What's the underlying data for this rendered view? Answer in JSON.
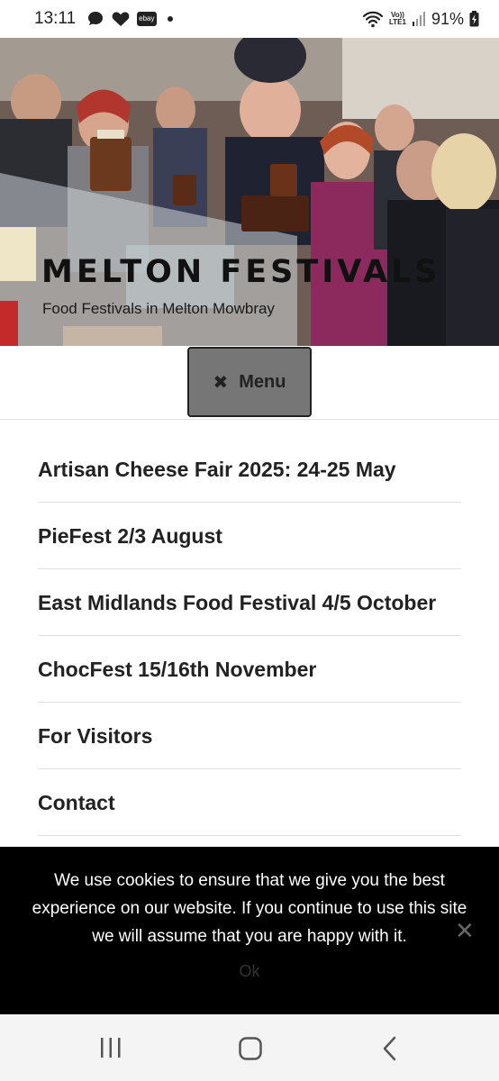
{
  "status_bar": {
    "time": "13:11",
    "ebay_label": "ebay",
    "volte_top": "Vo))",
    "volte_bottom": "LTE1",
    "battery": "91%",
    "icons": [
      "chat-bubble-icon",
      "heart-icon",
      "ebay-icon",
      "notification-dot-icon",
      "wifi-icon",
      "signal-icon",
      "battery-icon"
    ]
  },
  "header": {
    "site_title": "MELTON FESTIVALS",
    "tagline": "Food Festivals in Melton Mowbray"
  },
  "menu_toggle": {
    "label": "Menu",
    "icon": "close-icon"
  },
  "nav": {
    "items": [
      {
        "label": "Artisan Cheese Fair 2025: 24-25 May"
      },
      {
        "label": "PieFest 2/3 August"
      },
      {
        "label": "East Midlands Food Festival 4/5 October"
      },
      {
        "label": "ChocFest 15/16th November"
      },
      {
        "label": "For Visitors"
      },
      {
        "label": "Contact"
      }
    ]
  },
  "cookie_notice": {
    "text": "We use cookies to ensure that we give you the best experience on our website. If you continue to use this site we will assume that you are happy with it.",
    "ok_label": "Ok",
    "close_icon": "close-x-icon"
  },
  "android_nav": {
    "icons": [
      "recent-apps-icon",
      "home-icon",
      "back-icon"
    ]
  },
  "colors": {
    "menu_button_bg": "#767676",
    "cookie_bg": "#000000",
    "text": "#222222"
  }
}
